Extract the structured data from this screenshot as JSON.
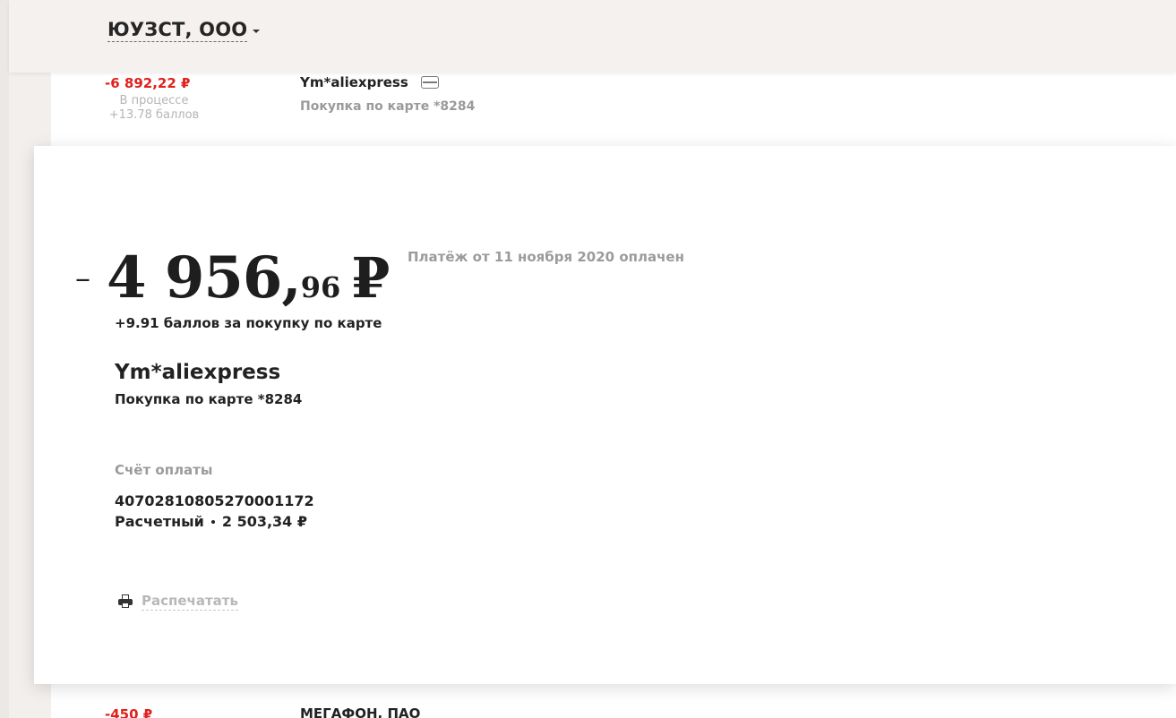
{
  "header": {
    "company_name": "ЮУЗСТ, ООО"
  },
  "list": {
    "top_row": {
      "amount": "-6 892,22 ₽",
      "status": "В процессе",
      "bonus": "+13.78 баллов",
      "merchant": "Ym*aliexpress",
      "description": "Покупка по карте *8284"
    },
    "bottom_row": {
      "amount": "-450 ₽",
      "merchant": "МЕГАФОН, ПАО"
    }
  },
  "detail": {
    "minus": "–",
    "amount_integer": "4 956,",
    "amount_decimal": "96",
    "currency": "₽",
    "status": "Платёж от 11 ноября 2020 оплачен",
    "bonus": "+9.91 баллов за покупку по карте",
    "merchant": "Ym*aliexpress",
    "description": "Покупка по карте *8284",
    "account_label": "Счёт оплаты",
    "account_number": "40702810805270001172",
    "account_type": "Расчетный",
    "account_balance": "2 503,34 ₽",
    "print_label": "Распечатать"
  },
  "icons": {
    "company_dropdown": "chevron-down-icon",
    "card": "card-icon",
    "print": "printer-icon"
  },
  "colors": {
    "negative_amount": "#e0211c",
    "muted_text": "#9b9b9b",
    "background": "#f2efed"
  }
}
